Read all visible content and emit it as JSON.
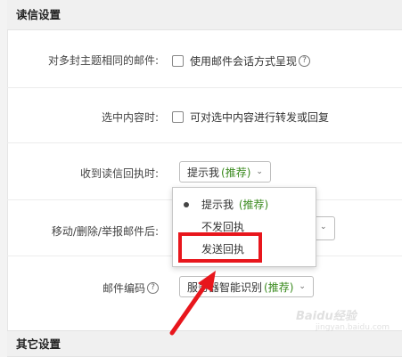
{
  "sections": {
    "read_settings": "读信设置",
    "other_settings": "其它设置"
  },
  "rows": {
    "thread": {
      "label": "对多封主题相同的邮件:",
      "option": "使用邮件会话方式呈现"
    },
    "selection": {
      "label": "选中内容时:",
      "option": "可对选中内容进行转发或回复"
    },
    "receipt": {
      "label": "收到读信回执时:",
      "select_value": "提示我",
      "select_tag": "(推荐)"
    },
    "move": {
      "label": "移动/删除/举报邮件后:"
    },
    "encoding": {
      "label": "邮件编码",
      "select_value": "服务器智能识别",
      "select_tag": "(推荐)"
    }
  },
  "dropdown": {
    "items": [
      {
        "label": "提示我",
        "tag": "(推荐)",
        "selected": true
      },
      {
        "label": "不发回执",
        "tag": "",
        "selected": false
      },
      {
        "label": "发送回执",
        "tag": "",
        "selected": false
      }
    ]
  },
  "icons": {
    "help": "?",
    "chevron": "⌄"
  },
  "watermark": {
    "text": "Baidu经验",
    "sub": "jingyan.baidu.com"
  },
  "colors": {
    "highlight": "#e8161c",
    "recommend": "#3a8a1e"
  }
}
